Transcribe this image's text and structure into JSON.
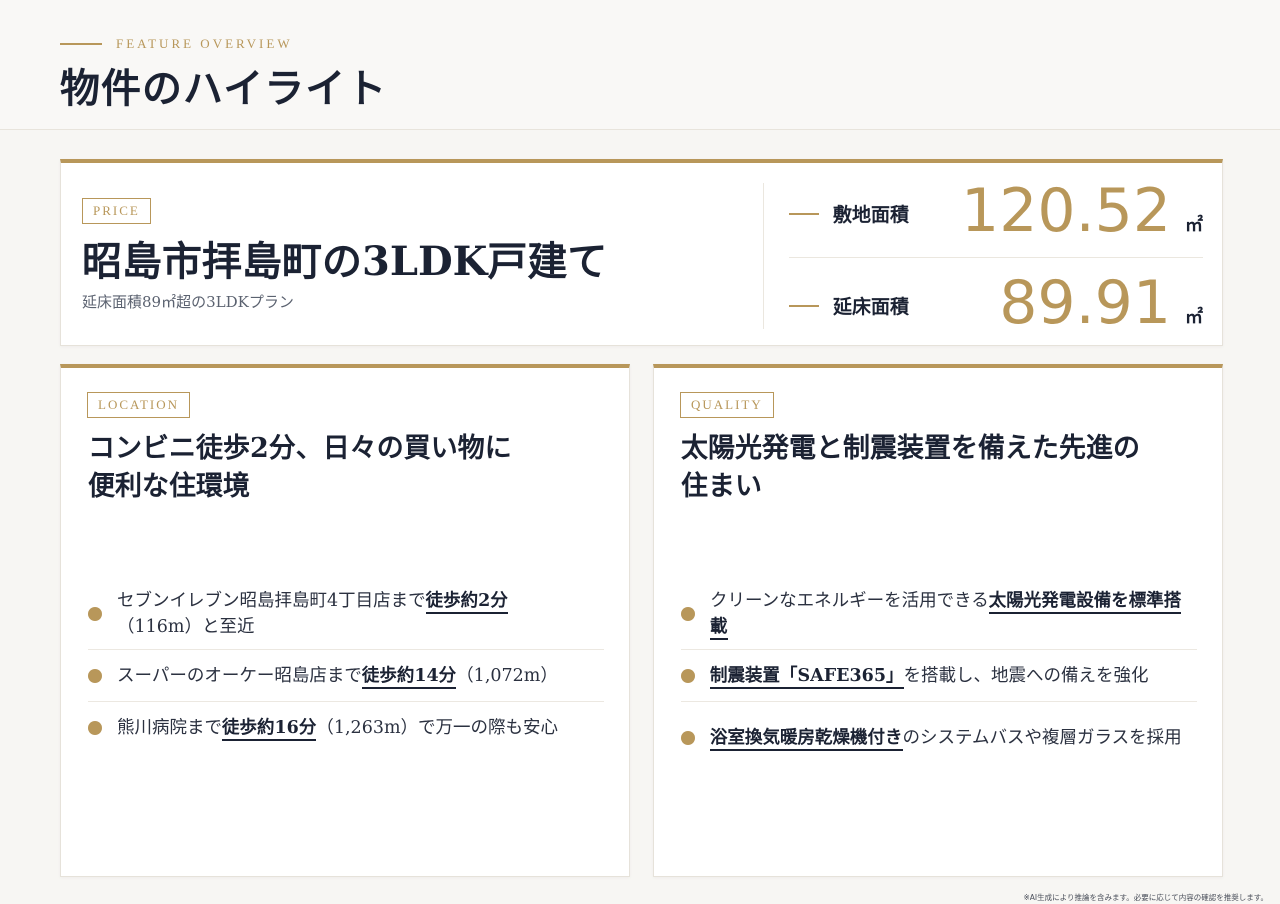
{
  "header": {
    "eyebrow": "FEATURE OVERVIEW",
    "title": "物件のハイライト"
  },
  "price_card": {
    "tag": "PRICE",
    "title": "昭島市拝島町の3LDK戸建て",
    "subtitle": "延床面積89㎡超の3LDKプラン",
    "stats": [
      {
        "label": "敷地面積",
        "value": "120.52",
        "unit": "㎡"
      },
      {
        "label": "延床面積",
        "value": "89.91",
        "unit": "㎡"
      }
    ]
  },
  "location_card": {
    "tag": "LOCATION",
    "heading_line1": "コンビニ徒歩2分、日々の買い物に",
    "heading_line2": "便利な住環境",
    "items": [
      {
        "pre": "セブンイレブン昭島拝島町4丁目店まで",
        "hl": "徒歩約2分",
        "post": "（116m）と至近"
      },
      {
        "pre": "スーパーのオーケー昭島店まで",
        "hl": "徒歩約14分",
        "post": "（1,072m）"
      },
      {
        "pre": "熊川病院まで",
        "hl": "徒歩約16分",
        "post": "（1,263m）で万一の際も安心"
      }
    ]
  },
  "quality_card": {
    "tag": "QUALITY",
    "heading_line1": "太陽光発電と制震装置を備えた先進の",
    "heading_line2": "住まい",
    "items": [
      {
        "pre": "クリーンなエネルギーを活用できる",
        "hl": "太陽光発電設備を標準搭載",
        "post": ""
      },
      {
        "pre": "",
        "hl": "制震装置「SAFE365」",
        "post": "を搭載し、地震への備えを強化"
      },
      {
        "pre": "",
        "hl": "浴室換気暖房乾燥機付き",
        "post": "のシステムバスや複層ガラスを採用"
      }
    ]
  },
  "disclaimer": "※AI生成により推論を含みます。必要に応じて内容の確認を推奨します。",
  "colors": {
    "accent": "#b8975a",
    "ink": "#1b2233",
    "background": "#f7f6f3"
  }
}
